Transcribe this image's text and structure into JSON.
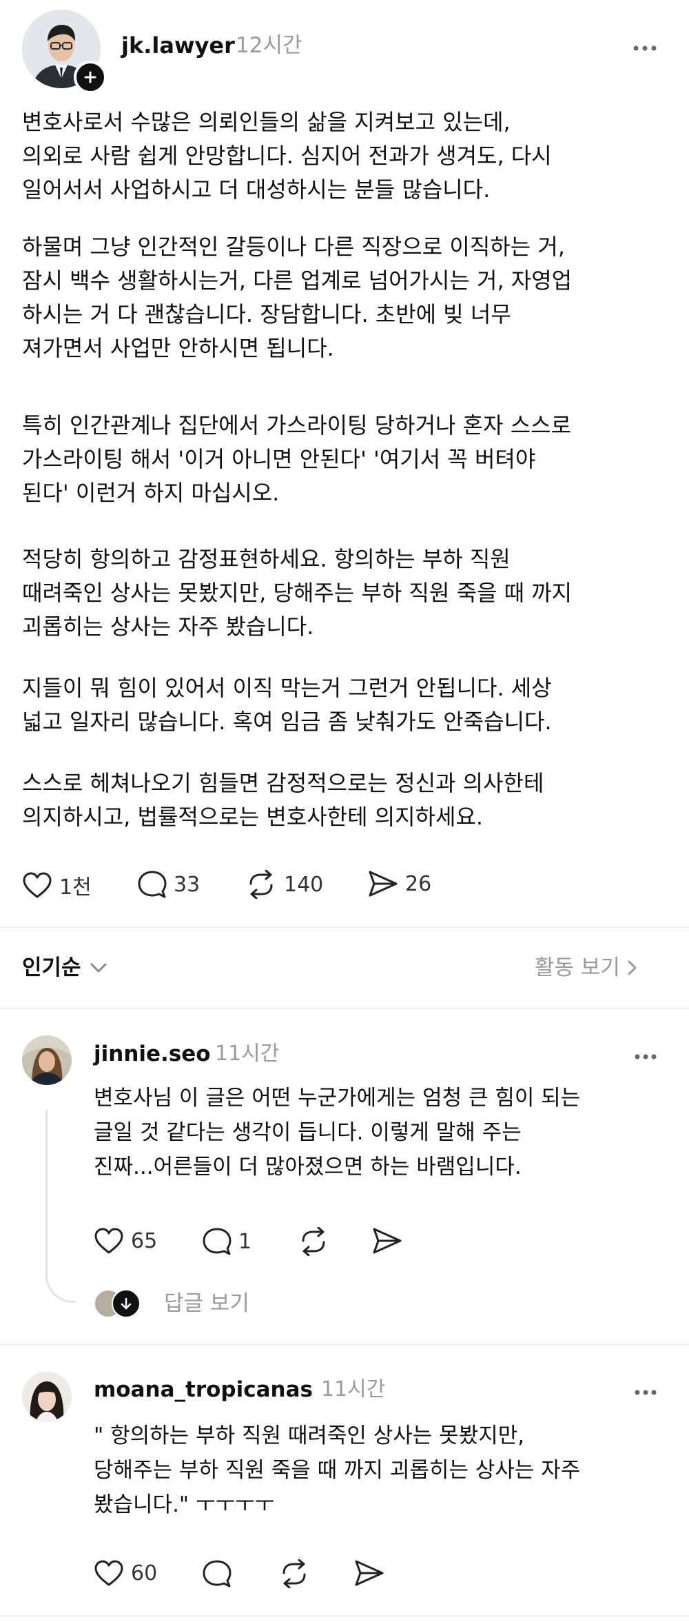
{
  "post": {
    "username": "jk.lawyer",
    "time": "12시간",
    "more_icon": "more-dots-icon",
    "paragraphs": [
      [
        "변호사로서 수많은 의뢰인들의 삶을 지켜보고 있는데,",
        "의외로 사람 쉽게 안망합니다. 심지어 전과가 생겨도, 다시",
        "일어서서 사업하시고 더 대성하시는 분들 많습니다."
      ],
      [
        "하물며 그냥 인간적인 갈등이나 다른 직장으로 이직하는 거,",
        "잠시 백수 생활하시는거, 다른 업계로 넘어가시는 거, 자영업",
        "하시는 거 다 괜찮습니다. 장담합니다. 초반에 빚 너무",
        "져가면서 사업만 안하시면 됩니다."
      ],
      [
        "특히 인간관계나 집단에서 가스라이팅 당하거나 혼자 스스로",
        "가스라이팅 해서 '이거 아니면 안된다' '여기서 꼭 버텨야",
        "된다' 이런거 하지 마십시오."
      ],
      [
        "적당히 항의하고 감정표현하세요. 항의하는 부하 직원",
        "때려죽인 상사는 못봤지만, 당해주는 부하 직원 죽을 때 까지",
        "괴롭히는 상사는 자주 봤습니다."
      ],
      [
        "지들이 뭐 힘이 있어서 이직 막는거 그런거 안됩니다. 세상",
        "넓고 일자리 많습니다. 혹여 임금 좀 낮춰가도 안죽습니다."
      ],
      [
        "스스로 헤쳐나오기 힘들면 감정적으로는 정신과 의사한테",
        "의지하시고, 법률적으로는 변호사한테 의지하세요."
      ]
    ],
    "likes": "1천",
    "comments": "33",
    "reposts": "140",
    "shares": "26"
  },
  "sort": {
    "label": "인기순",
    "activity_label": "활동 보기"
  },
  "replies": [
    {
      "username": "jinnie.seo",
      "time": "11시간",
      "lines": [
        "변호사님 이 글은 어떤 누군가에게는 엄청 큰 힘이 되는",
        "글일 것 같다는 생각이 듭니다. 이렇게 말해 주는",
        "진짜...어른들이 더 많아졌으면 하는 바램입니다."
      ],
      "likes": "65",
      "comments": "1",
      "view_replies": "답글 보기"
    },
    {
      "username": "moana_tropicanas",
      "time": "11시간",
      "lines": [
        "\" 항의하는 부하 직원 때려죽인 상사는 못봤지만,",
        "당해주는 부하 직원 죽을 때 까지 괴롭히는 상사는 자주",
        "봤습니다.\" ㅜㅜㅜㅜ"
      ],
      "likes": "60"
    }
  ],
  "colors": {
    "text": "#111111",
    "muted": "#9a9a9a",
    "divider": "#efefef"
  }
}
